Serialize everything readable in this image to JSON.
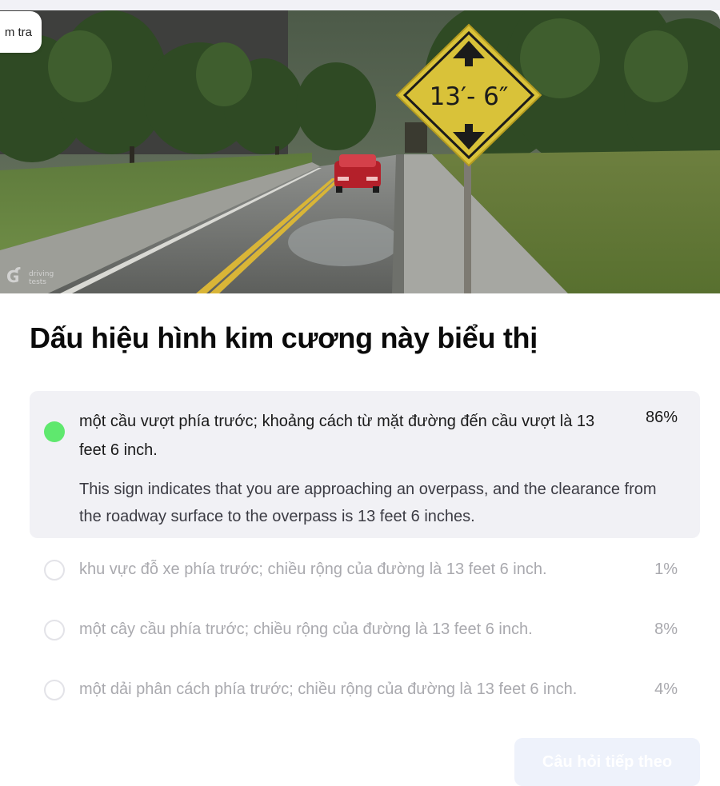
{
  "header": {
    "pill_label": "m tra"
  },
  "hero": {
    "sign_text": "13′- 6″",
    "watermark": "driving tests",
    "watermark_line1": "driving",
    "watermark_line2": "tests"
  },
  "question": {
    "title": "Dấu hiệu hình kim cương này biểu thị"
  },
  "answers": [
    {
      "text": "một cầu vượt phía trước; khoảng cách từ mặt đường đến cầu vượt là 13 feet 6 inch.",
      "percent": "86%",
      "selected": true,
      "correct": true,
      "explanation": "This sign indicates that you are approaching an overpass, and the clearance from the roadway surface to the overpass is 13 feet 6 inches."
    },
    {
      "text": "khu vực đỗ xe phía trước; chiều rộng của đường là 13 feet 6 inch.",
      "percent": "1%",
      "selected": false
    },
    {
      "text": "một cây cầu phía trước; chiều rộng của đường là 13 feet 6 inch.",
      "percent": "8%",
      "selected": false
    },
    {
      "text": "một dải phân cách phía trước; chiều rộng của đường là 13 feet 6 inch.",
      "percent": "4%",
      "selected": false
    }
  ],
  "footer": {
    "next_label": "Câu hỏi tiếp theo"
  },
  "colors": {
    "correct_dot": "#5fe86e",
    "selected_bg": "#f1f1f5",
    "muted_text": "#a9a9ae",
    "sign_yellow": "#e0c531"
  }
}
